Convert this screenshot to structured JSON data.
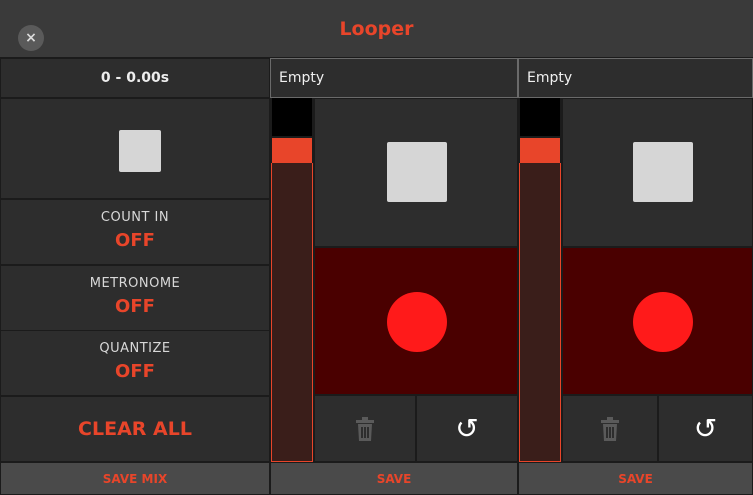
{
  "window": {
    "title": "Looper",
    "close_label": "×"
  },
  "master": {
    "time": "0 - 0.00s",
    "toggles": [
      {
        "label": "COUNT IN",
        "value": "OFF"
      },
      {
        "label": "METRONOME",
        "value": "OFF"
      },
      {
        "label": "QUANTIZE",
        "value": "OFF"
      }
    ],
    "clear_all": "CLEAR ALL",
    "save_mix": "SAVE MIX"
  },
  "tracks": [
    {
      "name": "Empty",
      "save": "SAVE",
      "undo_icon": "↺"
    },
    {
      "name": "Empty",
      "save": "SAVE",
      "undo_icon": "↺"
    }
  ],
  "colors": {
    "accent": "#e8452a",
    "record": "#ff1a1a",
    "record_bg": "#4a0000"
  }
}
